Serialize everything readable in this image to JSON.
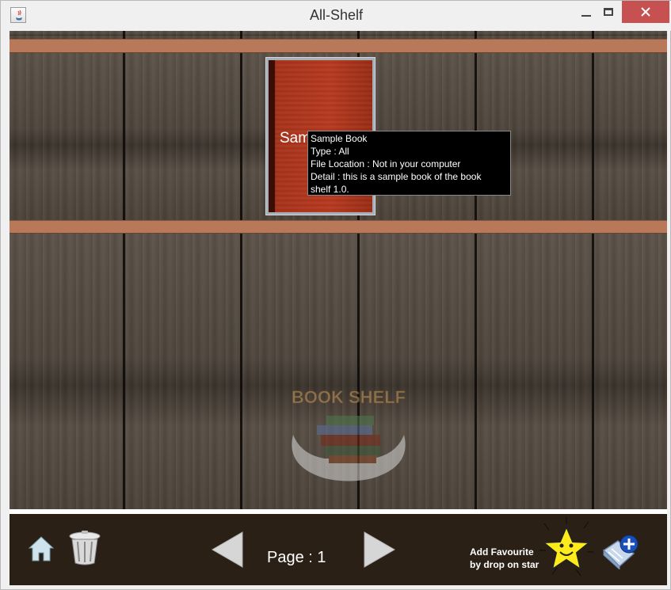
{
  "window": {
    "title": "All-Shelf"
  },
  "shelf": {
    "book": {
      "title": "Sample Book"
    },
    "tooltip": {
      "line1": "Sample Book",
      "line2": "Type : All",
      "line3": "File Location : Not in your computer",
      "line4": "Detail : this is a sample book of the book",
      "line5": "shelf 1.0."
    },
    "logo_text": "BOOK SHELF"
  },
  "footer": {
    "page_label": "Page : 1",
    "favourite_line1": "Add Favourite",
    "favourite_line2": "by drop on star",
    "icons": [
      "home-icon",
      "trash-icon",
      "previous-arrow-icon",
      "next-arrow-icon",
      "star-icon",
      "add-book-icon"
    ]
  },
  "colors": {
    "plank": "#b8795a",
    "bottom_bar": "#2a2016",
    "book_cover": "#b8391e",
    "close_button": "#c75050"
  }
}
